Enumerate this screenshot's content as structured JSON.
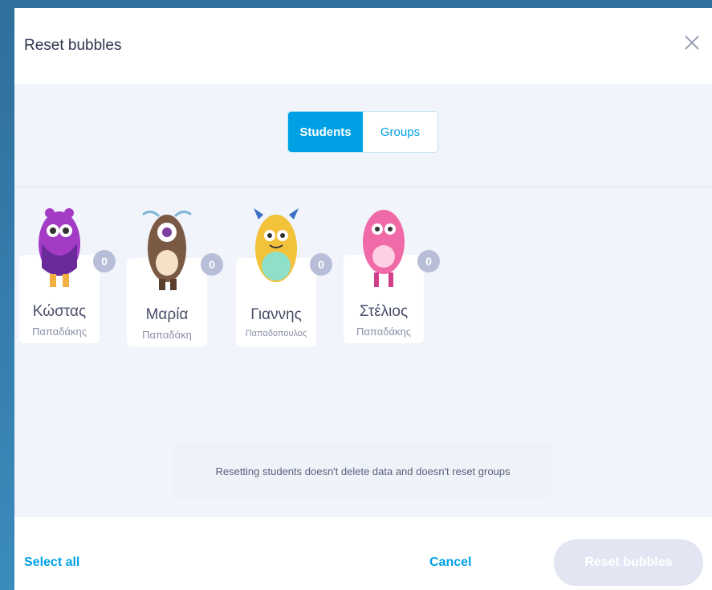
{
  "dialog": {
    "title": "Reset bubbles",
    "close_icon": "close-icon"
  },
  "tabs": [
    {
      "label": "Students",
      "active": true
    },
    {
      "label": "Groups",
      "active": false
    }
  ],
  "students": [
    {
      "first": "Κώστας",
      "last": "Παπαδάκης",
      "points": "0",
      "color": "#a33bc4"
    },
    {
      "first": "Μαρία",
      "last": "Παπαδάκη",
      "points": "0",
      "color": "#7a5a44"
    },
    {
      "first": "Γιαννης",
      "last": "Παπαδοπουλος",
      "points": "0",
      "color": "#f2c23a"
    },
    {
      "first": "Στέλιος",
      "last": "Παπαδάκης",
      "points": "0",
      "color": "#f06aa7"
    }
  ],
  "notice": "Resetting students doesn't delete data and doesn't reset groups",
  "footer": {
    "select_all": "Select all",
    "cancel": "Cancel",
    "reset": "Reset bubbles"
  },
  "colors": {
    "accent": "#00a1e4",
    "badge": "#b8bed8",
    "disabled_button": "#e3e6f2"
  }
}
